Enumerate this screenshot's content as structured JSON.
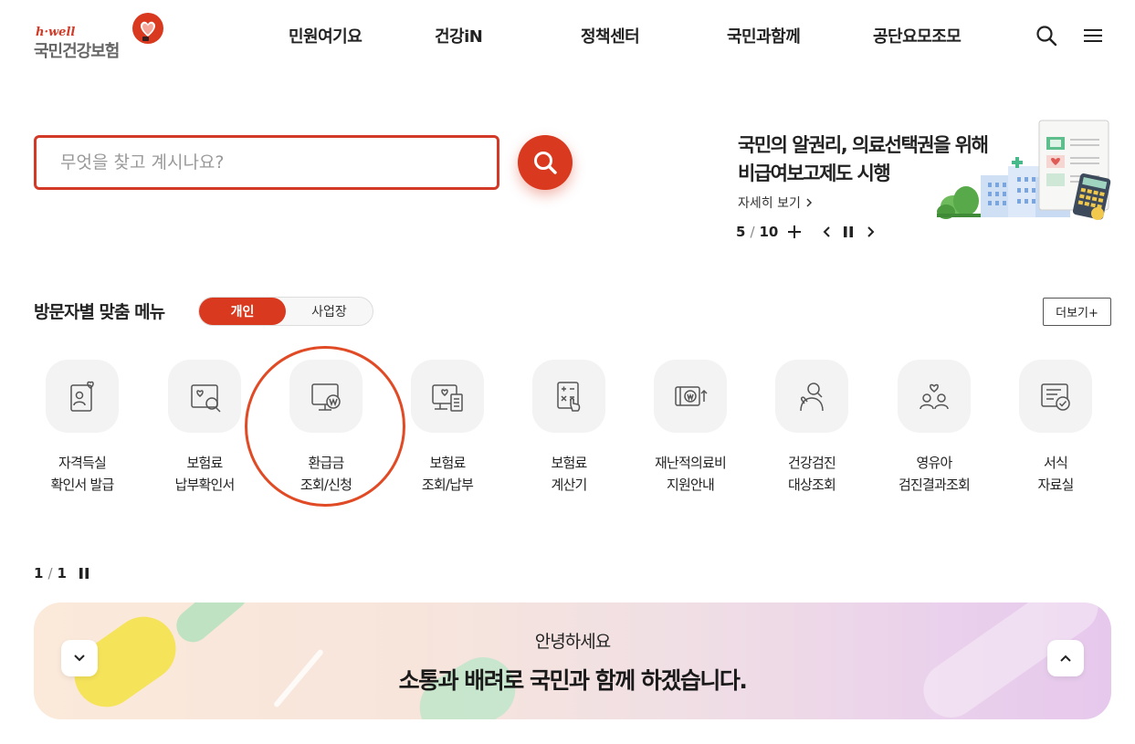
{
  "header": {
    "logo_small": "h·well",
    "logo_main": "국민건강보험",
    "nav": [
      "민원여기요",
      "건강iN",
      "정책센터",
      "국민과함께",
      "공단요모조모"
    ]
  },
  "search": {
    "placeholder": "무엇을 찾고 계시나요?"
  },
  "banner": {
    "title_line1": "국민의 알권리, 의료선택권을 위해",
    "title_line2": "비급여보고제도 시행",
    "more_label": "자세히 보기",
    "current": "5",
    "separator": "/",
    "total": "10"
  },
  "visitor_menu": {
    "title": "방문자별 맞춤 메뉴",
    "toggle_active": "개인",
    "toggle_inactive": "사업장",
    "more_label": "더보기+",
    "items": [
      {
        "label": "자격득실\n확인서 발급"
      },
      {
        "label": "보험료\n납부확인서"
      },
      {
        "label": "환급금\n조회/신청"
      },
      {
        "label": "보험료\n조회/납부"
      },
      {
        "label": "보험료\n계산기"
      },
      {
        "label": "재난적의료비\n지원안내"
      },
      {
        "label": "건강검진\n대상조회"
      },
      {
        "label": "영유아\n검진결과조회"
      },
      {
        "label": "서식\n자료실"
      }
    ],
    "pager": {
      "current": "1",
      "separator": "/",
      "total": "1"
    }
  },
  "greeting": {
    "sub": "안녕하세요",
    "main": "소통과 배려로 국민과 함께 하겠습니다."
  },
  "colors": {
    "brand": "#d9391f",
    "highlight": "#e04a25"
  }
}
